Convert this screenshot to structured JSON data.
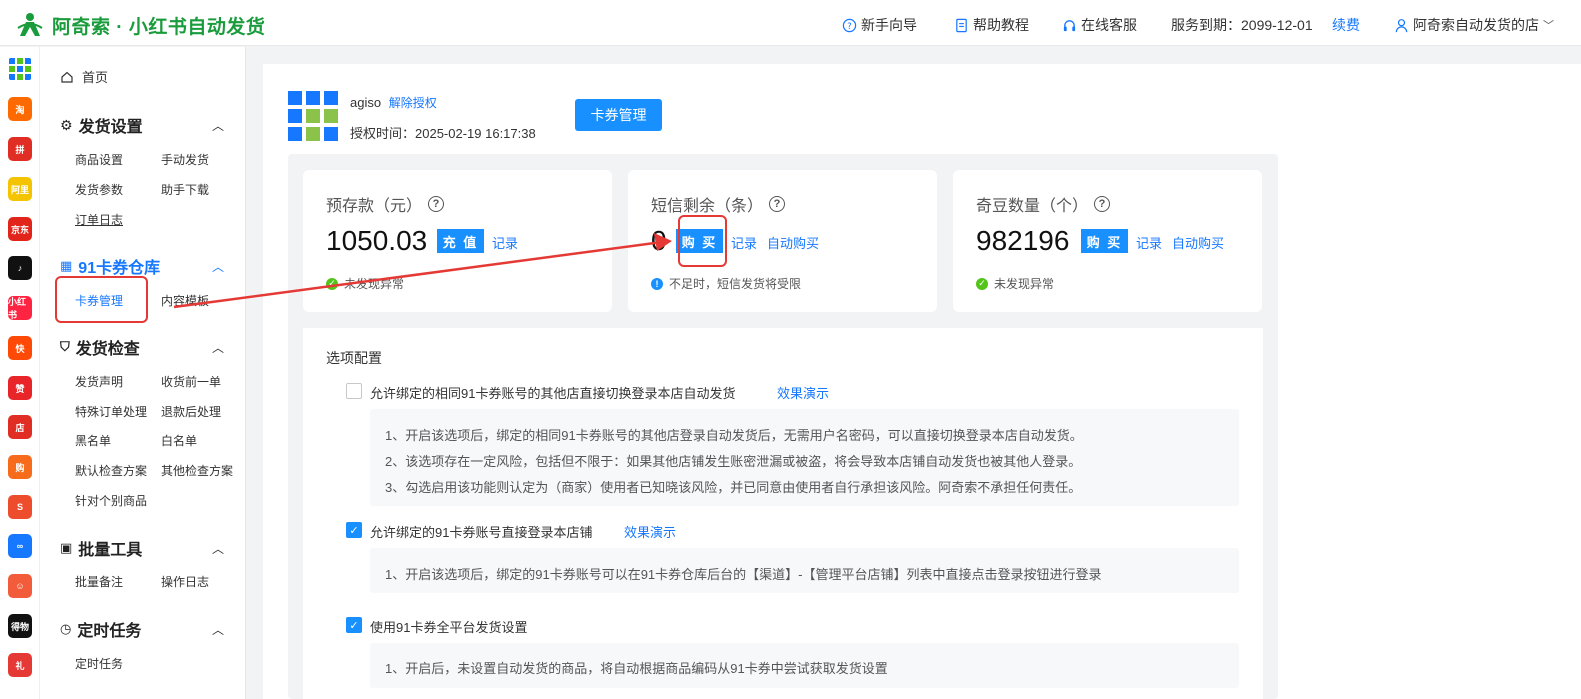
{
  "header": {
    "app_title": "阿奇索 · 小红书自动发货",
    "nav": {
      "guide": "新手向导",
      "help": "帮助教程",
      "service": "在线客服",
      "expiry": "服务到期：2099-12-01",
      "renew": "续费",
      "user": "阿奇索自动发货的店"
    }
  },
  "platforms": [
    {
      "name": "grid-icon",
      "color": "#ffffff",
      "text": ""
    },
    {
      "name": "taobao-icon",
      "color": "#ff6a00",
      "text": "淘"
    },
    {
      "name": "pinduoduo-icon",
      "color": "#e02e24",
      "text": "拼"
    },
    {
      "name": "alibaba-icon",
      "color": "#f5c400",
      "text": "阿里"
    },
    {
      "name": "jd-icon",
      "color": "#e1251b",
      "text": "京东"
    },
    {
      "name": "douyin-icon",
      "color": "#111111",
      "text": "♪"
    },
    {
      "name": "xiaohongshu-icon",
      "color": "#ff2442",
      "text": "小红书"
    },
    {
      "name": "kuaishou-icon",
      "color": "#ff4906",
      "text": "快"
    },
    {
      "name": "thumb-icon",
      "color": "#e8262a",
      "text": "赞"
    },
    {
      "name": "store-icon",
      "color": "#e02e24",
      "text": "店"
    },
    {
      "name": "bag-icon",
      "color": "#f76b1c",
      "text": "购"
    },
    {
      "name": "shopee-icon",
      "color": "#ee4d2d",
      "text": "S"
    },
    {
      "name": "link-icon",
      "color": "#1677ff",
      "text": "∞"
    },
    {
      "name": "smile-icon",
      "color": "#f25c3a",
      "text": "☺"
    },
    {
      "name": "dewu-icon",
      "color": "#111111",
      "text": "得物"
    },
    {
      "name": "gift-icon",
      "color": "#e53935",
      "text": "礼"
    }
  ],
  "sidebar": {
    "home": "首页",
    "sections": [
      {
        "title": "发货设置",
        "items": [
          "商品设置",
          "手动发货",
          "发货参数",
          "助手下载",
          "订单日志"
        ]
      },
      {
        "title": "91卡券仓库",
        "items": [
          "卡券管理",
          "内容模板"
        ]
      },
      {
        "title": "发货检查",
        "items": [
          "发货声明",
          "收货前一单",
          "特殊订单处理",
          "退款后处理",
          "黑名单",
          "白名单",
          "默认检查方案",
          "其他检查方案",
          "针对个别商品"
        ]
      },
      {
        "title": "批量工具",
        "items": [
          "批量备注",
          "操作日志"
        ]
      },
      {
        "title": "定时任务",
        "items": [
          "定时任务"
        ]
      }
    ]
  },
  "shop": {
    "name": "agiso",
    "unbind": "解除授权",
    "auth_time": "授权时间：2025-02-19 16:17:38",
    "card_button": "卡券管理"
  },
  "cards": [
    {
      "title": "预存款（元）",
      "value": "1050.03",
      "button": "充 值",
      "links": [
        "记录"
      ],
      "status": "未发现异常",
      "status_color": "#52c41a"
    },
    {
      "title": "短信剩余（条）",
      "value": "0",
      "button": "购 买",
      "links": [
        "记录",
        "自动购买"
      ],
      "status": "不足时，短信发货将受限",
      "status_color": "#1890ff"
    },
    {
      "title": "奇豆数量（个）",
      "value": "982196",
      "button": "购 买",
      "links": [
        "记录",
        "自动购买"
      ],
      "status": "未发现异常",
      "status_color": "#52c41a"
    }
  ],
  "options": {
    "title": "选项配置",
    "items": [
      {
        "label": "允许绑定的相同91卡券账号的其他店直接切换登录本店自动发货",
        "demo": "效果演示",
        "checked": false,
        "desc": [
          "1、开启该选项后，绑定的相同91卡券账号的其他店登录自动发货后，无需用户名密码，可以直接切换登录本店自动发货。",
          "2、该选项存在一定风险，包括但不限于：如果其他店铺发生账密泄漏或被盗，将会导致本店铺自动发货也被其他人登录。",
          "3、勾选启用该功能则认定为（商家）使用者已知晓该风险，并已同意由使用者自行承担该风险。阿奇索不承担任何责任。"
        ]
      },
      {
        "label": "允许绑定的91卡券账号直接登录本店铺",
        "demo": "效果演示",
        "checked": true,
        "desc": [
          "1、开启该选项后，绑定的91卡券账号可以在91卡券仓库后台的【渠道】-【管理平台店铺】列表中直接点击登录按钮进行登录"
        ]
      },
      {
        "label": "使用91卡券全平台发货设置",
        "demo": "",
        "checked": true,
        "desc": [
          "1、开启后，未设置自动发货的商品，将自动根据商品编码从91卡券中尝试获取发货设置"
        ]
      }
    ]
  }
}
